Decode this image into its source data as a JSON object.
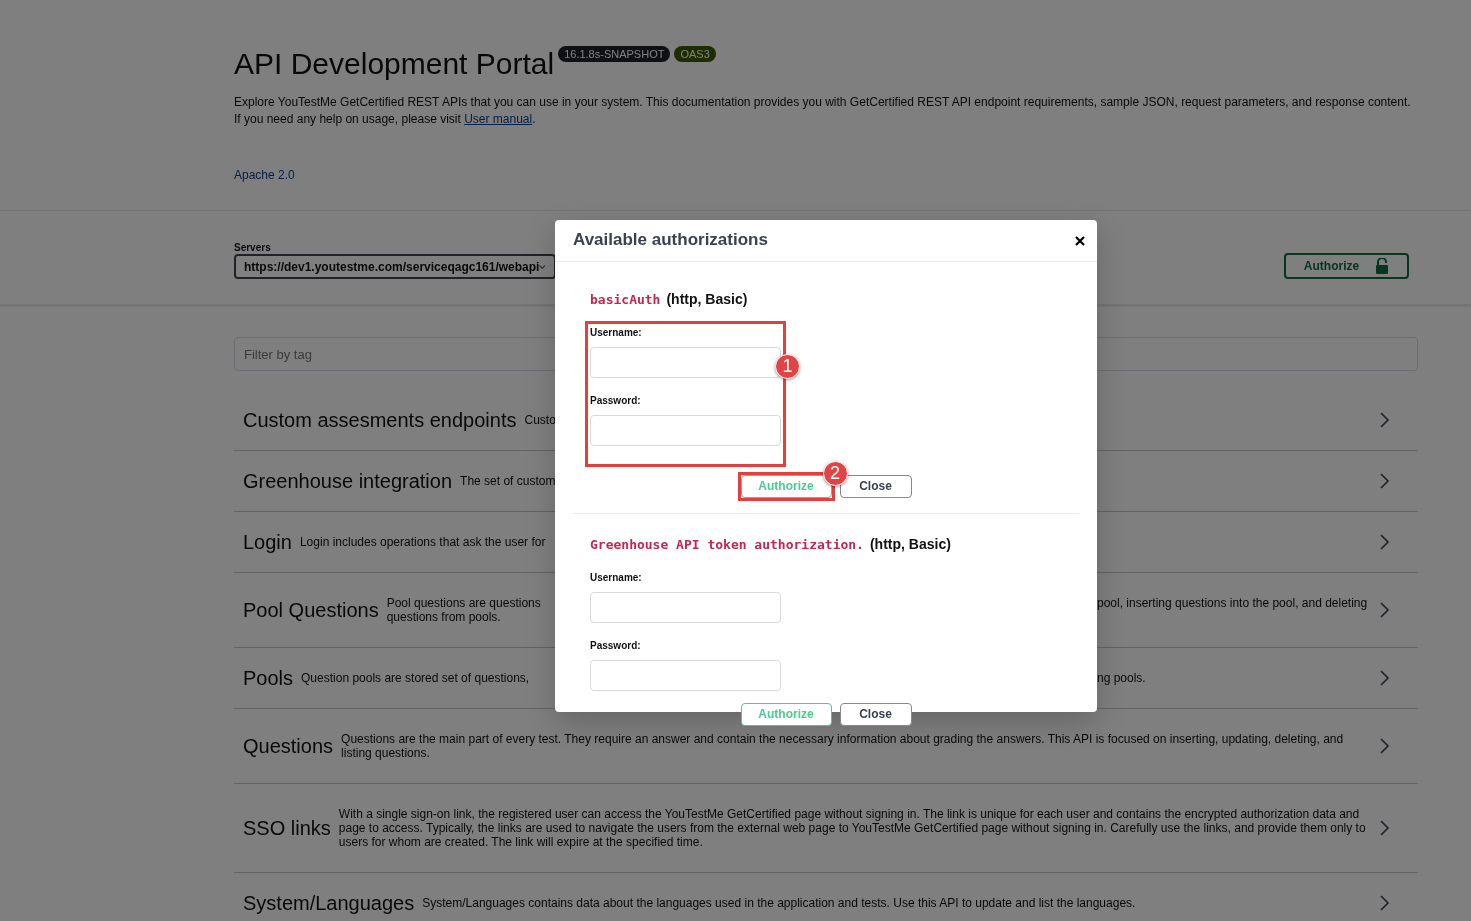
{
  "info": {
    "title": "API Development Portal",
    "version": "16.1.8s-SNAPSHOT",
    "spec": "OAS3",
    "description": "Explore YouTestMe GetCertified REST APIs that you can use in your system. This documentation provides you with GetCertified REST API endpoint requirements, sample JSON, request parameters, and response content. If you need any help on usage, please visit ",
    "manual_link": "User manual",
    "description_end": ".",
    "license": "Apache 2.0"
  },
  "servers": {
    "label": "Servers",
    "value": "https://dev1.youtestme.com/serviceqagc161/webapi"
  },
  "authorize_button": {
    "label": "Authorize",
    "locked": false
  },
  "filter": {
    "placeholder": "Filter by tag"
  },
  "tags": [
    {
      "name": "Custom assesments endpoints",
      "description_left": [
        "Custo"
      ],
      "expanded": false
    },
    {
      "name": "Greenhouse integration",
      "description_left": [
        "The set of custom"
      ],
      "expanded": false
    },
    {
      "name": "Login",
      "description_left": [
        "Login includes operations that ask the user for"
      ],
      "expanded": false
    },
    {
      "name": "Pool Questions",
      "description_left": [
        "Pool questions are questions",
        "questions from pools."
      ],
      "description_right": [
        "pool, inserting questions into the pool, and deleting"
      ],
      "expanded": false
    },
    {
      "name": "Pools",
      "description_left": [
        "Question pools are stored set of questions,"
      ],
      "description_right": [
        "ng pools."
      ],
      "expanded": false
    },
    {
      "name": "Questions",
      "description_left": [
        "Questions are the main part of every test. They require an answer and contain the necessary information about grading the answers. This API is focused on inserting, updating, deleting, and listing questions."
      ],
      "expanded": false
    },
    {
      "name": "SSO links",
      "description_left": [
        "With a single sign-on link, the registered user can access the YouTestMe GetCertified page without signing in. The link is unique for each user and contains the encrypted authorization data and page to access. Typically, the links are used to navigate the users from the external web page to YouTestMe GetCertified page without signing in. Carefully use the links, and provide them only to users for whom are created. The link will expire at the specified time."
      ],
      "expanded": false
    },
    {
      "name": "System/Languages",
      "description_left": [
        "System/Languages contains data about the languages used in the application and tests. Use this API to update and list the languages."
      ],
      "expanded": false
    }
  ],
  "modal": {
    "title": "Available authorizations",
    "schemes": [
      {
        "name": "basicAuth",
        "type": "(http, Basic)",
        "fields": [
          {
            "label": "Username:"
          },
          {
            "label": "Password:"
          }
        ],
        "authorize": "Authorize",
        "close": "Close",
        "annotations": [
          {
            "kind": "fields",
            "label": "1"
          },
          {
            "kind": "authorize",
            "label": "2"
          }
        ]
      },
      {
        "name": "Greenhouse API token authorization.",
        "type": "(http, Basic)",
        "fields": [
          {
            "label": "Username:"
          },
          {
            "label": "Password:"
          }
        ],
        "authorize": "Authorize",
        "close": "Close"
      }
    ]
  }
}
